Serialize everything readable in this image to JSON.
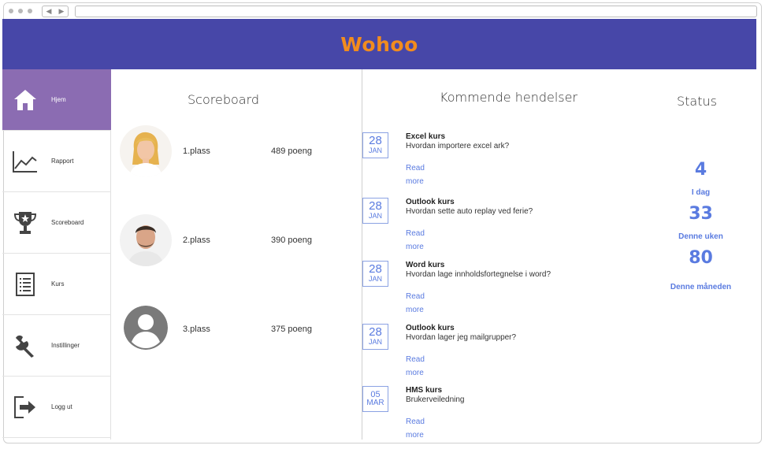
{
  "app": {
    "logo": "Wohoo"
  },
  "sidebar": {
    "items": [
      {
        "label": "Hjem",
        "icon": "home-icon",
        "active": true
      },
      {
        "label": "Rapport",
        "icon": "chart-icon"
      },
      {
        "label": "Scoreboard",
        "icon": "trophy-icon"
      },
      {
        "label": "Kurs",
        "icon": "list-icon"
      },
      {
        "label": "Instillinger",
        "icon": "wrench-icon"
      },
      {
        "label": "Logg ut",
        "icon": "logout-icon"
      }
    ]
  },
  "scoreboard": {
    "title": "Scoreboard",
    "players": [
      {
        "place": "1.plass",
        "points": "489 poeng"
      },
      {
        "place": "2.plass",
        "points": "390 poeng"
      },
      {
        "place": "3.plass",
        "points": "375 poeng"
      }
    ]
  },
  "events": {
    "title": "Kommende hendelser",
    "items": [
      {
        "day": "28",
        "month": "JAN",
        "title": "Excel kurs",
        "desc": "Hvordan importere excel ark?",
        "read": "Read",
        "more": "more"
      },
      {
        "day": "28",
        "month": "JAN",
        "title": "Outlook kurs",
        "desc": "Hvordan sette auto replay ved ferie?",
        "read": "Read",
        "more": "more"
      },
      {
        "day": "28",
        "month": "JAN",
        "title": "Word kurs",
        "desc": "Hvordan lage innholdsfortegnelse i word?",
        "read": "Read",
        "more": "more"
      },
      {
        "day": "28",
        "month": "JAN",
        "title": "Outlook kurs",
        "desc": "Hvordan lager jeg mailgrupper?",
        "read": "Read",
        "more": "more"
      },
      {
        "day": "05",
        "month": "MAR",
        "title": "HMS kurs",
        "desc": "Brukerveiledning",
        "read": "Read",
        "more": "more"
      }
    ]
  },
  "status": {
    "title": "Status",
    "stats": [
      {
        "value": "4",
        "label": "I dag"
      },
      {
        "value": "33",
        "label": "Denne  uken"
      },
      {
        "value": "80",
        "label": "Denne måneden"
      }
    ]
  },
  "colors": {
    "header": "#4747a8",
    "logo": "#f28c1e",
    "accent": "#5a7be0",
    "active_nav": "#8b6cb2"
  }
}
